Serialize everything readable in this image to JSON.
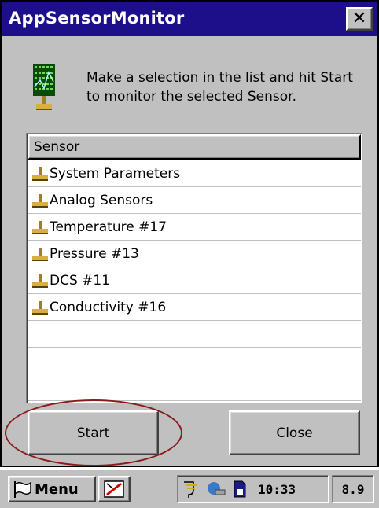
{
  "window": {
    "title": "AppSensorMonitor",
    "close_label": "✕",
    "instructions": "Make a selection in the list and hit Start to monitor the selected Sensor."
  },
  "list": {
    "header": "Sensor",
    "items": [
      {
        "label": "System Parameters",
        "icon": "sensor-icon"
      },
      {
        "label": "Analog Sensors",
        "icon": "sensor-icon"
      },
      {
        "label": "Temperature #17",
        "icon": "sensor-icon"
      },
      {
        "label": "Pressure #13",
        "icon": "sensor-icon"
      },
      {
        "label": "DCS #11",
        "icon": "sensor-icon"
      },
      {
        "label": "Conductivity #16",
        "icon": "sensor-icon"
      },
      {
        "label": "",
        "icon": ""
      },
      {
        "label": "",
        "icon": ""
      },
      {
        "label": "",
        "icon": ""
      },
      {
        "label": "",
        "icon": ""
      },
      {
        "label": "",
        "icon": ""
      }
    ]
  },
  "buttons": {
    "start": "Start",
    "close": "Close"
  },
  "taskbar": {
    "menu_label": "Menu",
    "clock": "10:33",
    "version": "8.9"
  },
  "colors": {
    "title_bar": "#1d0f8a",
    "face": "#c0c0c0",
    "highlight_ring": "#8b1a1a"
  }
}
